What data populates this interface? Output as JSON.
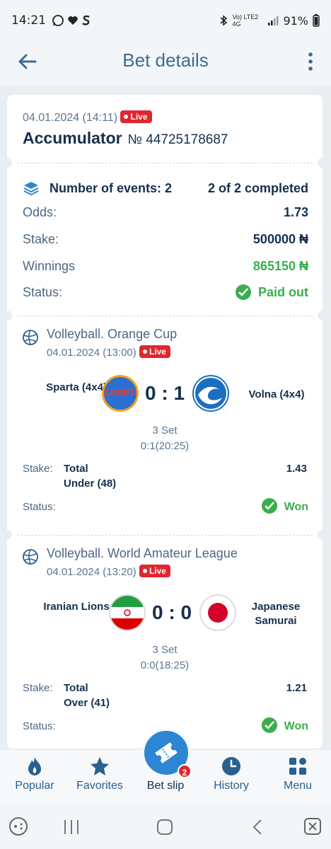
{
  "status_bar": {
    "time": "14:21",
    "network": "Vo) LTE2 4G",
    "battery": "91%"
  },
  "header": {
    "title": "Bet details"
  },
  "bet": {
    "date": "04.01.2024 (14:11)",
    "live_label": "Live",
    "type": "Accumulator",
    "number": "№ 44725178687"
  },
  "summary": {
    "events_label": "Number of events: 2",
    "completed": "2 of 2 completed",
    "odds_label": "Odds:",
    "odds_value": "1.73",
    "stake_label": "Stake:",
    "stake_value": "500000 ₦",
    "winnings_label": "Winnings",
    "winnings_value": "865150 ₦",
    "status_label": "Status:",
    "status_value": "Paid out"
  },
  "events": [
    {
      "league": "Volleyball. Orange Cup",
      "date": "04.01.2024 (13:00)",
      "live_label": "Live",
      "team1": "Sparta (4x4)",
      "team2": "Volna (4x4)",
      "team1_logo_text": "СПАРТА",
      "score": "0 : 1",
      "set": "3 Set",
      "set_score": "0:1(20:25)",
      "stake_label": "Stake:",
      "pick_line1": "Total",
      "pick_line2": "Under (48)",
      "odd": "1.43",
      "status_label": "Status:",
      "status_value": "Won"
    },
    {
      "league": "Volleyball. World Amateur League",
      "date": "04.01.2024 (13:20)",
      "live_label": "Live",
      "team1": "Iranian Lions",
      "team2": "Japanese Samurai",
      "score": "0 : 0",
      "set": "3 Set",
      "set_score": "0:0(18:25)",
      "stake_label": "Stake:",
      "pick_line1": "Total",
      "pick_line2": "Over (41)",
      "odd": "1.21",
      "status_label": "Status:",
      "status_value": "Won"
    }
  ],
  "bottom_nav": {
    "items": [
      {
        "label": "Popular",
        "icon": "flame-icon"
      },
      {
        "label": "Favorites",
        "icon": "star-icon"
      },
      {
        "label": "Bet slip",
        "icon": "ticket-icon"
      },
      {
        "label": "History",
        "icon": "clock-icon"
      },
      {
        "label": "Menu",
        "icon": "grid-icon"
      }
    ],
    "betslip_badge": "2"
  },
  "colors": {
    "primary_blue": "#2d86d3",
    "live_red": "#e0262e",
    "won_green": "#3aae4f",
    "title_text": "#3f6b8e"
  }
}
